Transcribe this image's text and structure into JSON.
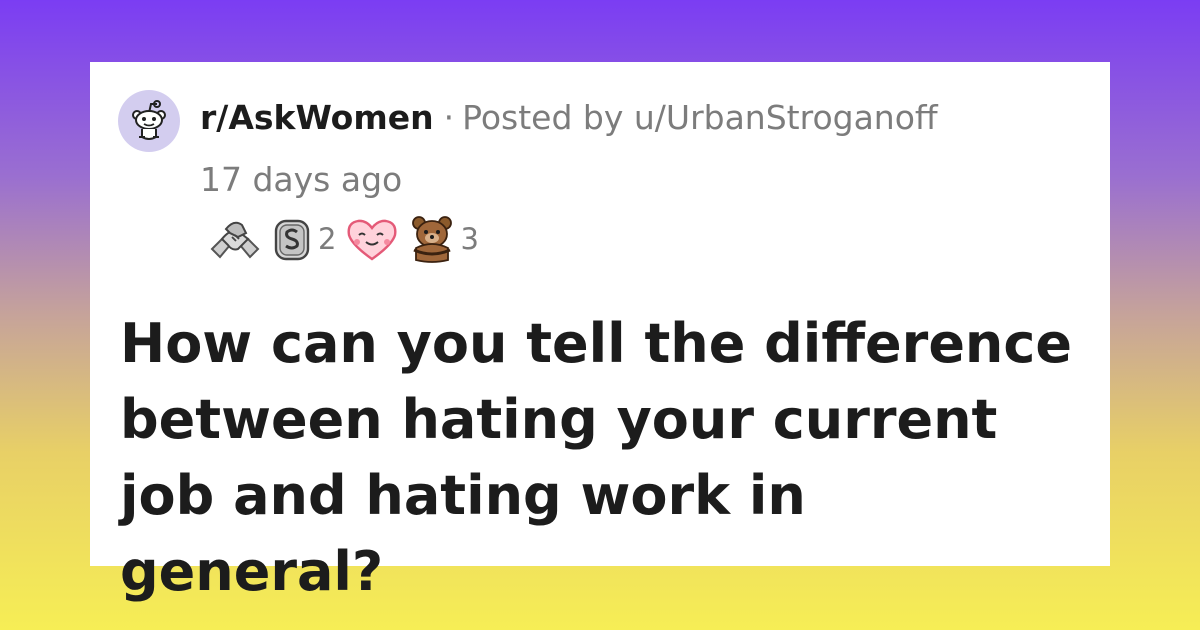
{
  "post": {
    "subreddit": "r/AskWomen",
    "separator": "·",
    "posted_by": "Posted by u/UrbanStroganoff",
    "time": "17 days ago",
    "title": "How can you tell the difference between hating your current job and hating work in general?"
  },
  "awards": [
    {
      "icon": "handshake-award-icon",
      "count": ""
    },
    {
      "icon": "silver-award-icon",
      "count": "2"
    },
    {
      "icon": "wholesome-heart-award-icon",
      "count": ""
    },
    {
      "icon": "bear-hug-award-icon",
      "count": "3"
    }
  ],
  "colors": {
    "background_top": "#7b3df3",
    "background_bottom": "#f6ee55",
    "card": "#ffffff",
    "avatar": "#d3cdef",
    "title_text": "#1c1c1c",
    "meta_text": "#7c7c7c"
  }
}
